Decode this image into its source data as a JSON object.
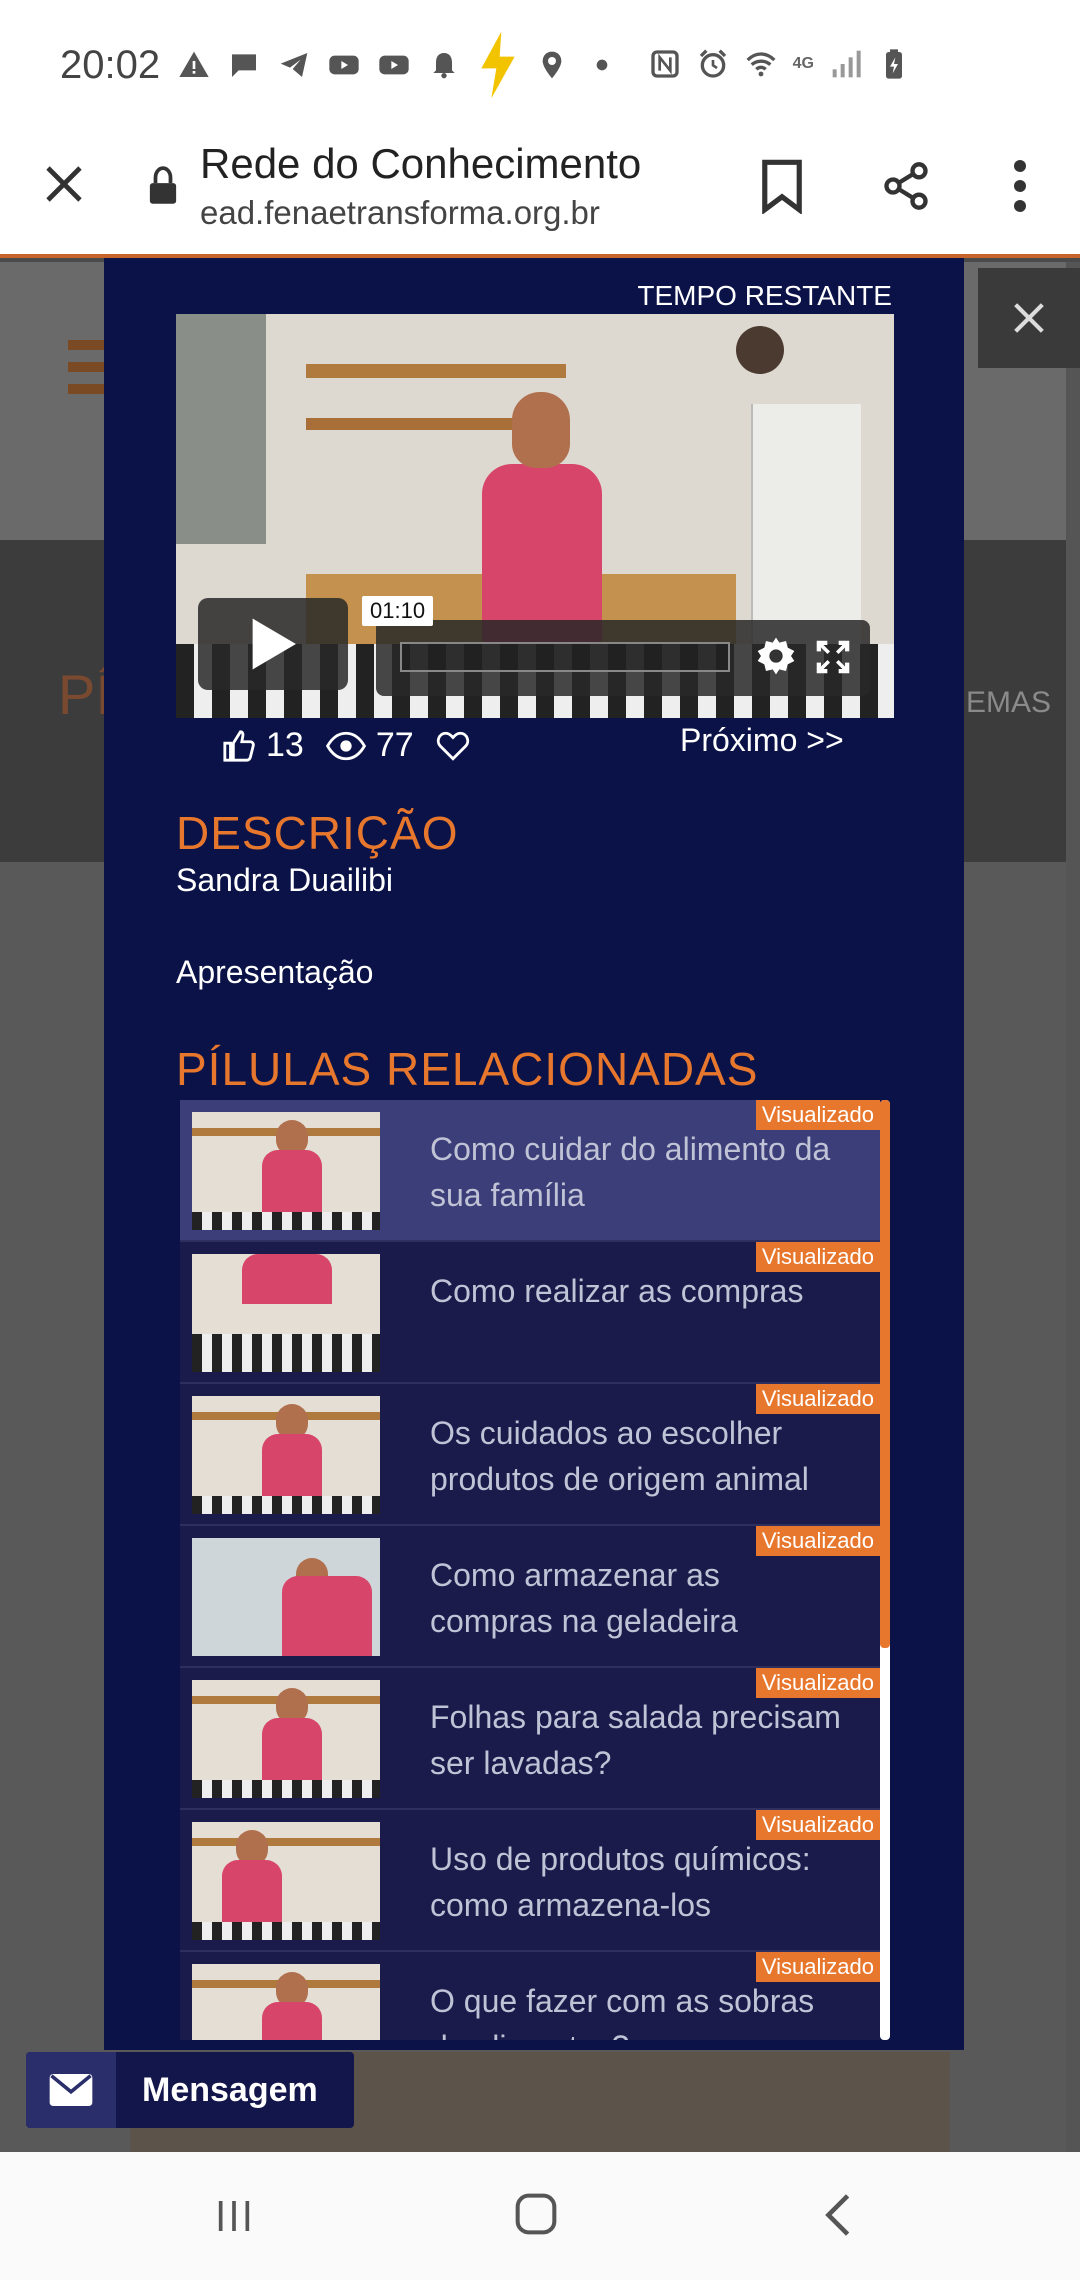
{
  "status_bar": {
    "time": "20:02",
    "icons_left": [
      "warning-icon",
      "chat-icon",
      "telegram-icon",
      "youtube-icon",
      "youtube-icon",
      "bell-icon",
      "bolt-icon",
      "location-icon",
      "dot-icon"
    ],
    "icons_right": [
      "nfc-icon",
      "alarm-icon",
      "wifi-icon",
      "4g-icon",
      "signal-icon",
      "battery-icon"
    ],
    "network": "4G"
  },
  "browser": {
    "title": "Rede do Conhecimento",
    "url": "ead.fenaetransforma.org.br"
  },
  "background_page": {
    "partial_heading": "PÍ",
    "partial_nav": "EMAS"
  },
  "modal": {
    "tempo_label": "TEMPO RESTANTE",
    "video": {
      "time_tooltip": "01:10"
    },
    "stats": {
      "likes": "13",
      "views": "77"
    },
    "next_label": "Próximo >>",
    "description_heading": "DESCRIÇÃO",
    "author": "Sandra Duailibi",
    "description_text": "Apresentação",
    "related_heading": "PÍLULAS RELACIONADAS",
    "related": [
      {
        "title": "Como cuidar do alimento da sua família",
        "badge": "Visualizado"
      },
      {
        "title": "Como realizar as compras",
        "badge": "Visualizado"
      },
      {
        "title": "Os cuidados ao escolher produtos de origem animal",
        "badge": "Visualizado"
      },
      {
        "title": "Como armazenar as compras na geladeira",
        "badge": "Visualizado"
      },
      {
        "title": "Folhas para salada precisam ser lavadas?",
        "badge": "Visualizado"
      },
      {
        "title": "Uso de produtos químicos: como armazena-los",
        "badge": "Visualizado"
      },
      {
        "title": "O que fazer com as sobras de alimentos?",
        "badge": "Visualizado"
      }
    ]
  },
  "message_button": {
    "label": "Mensagem"
  },
  "colors": {
    "accent": "#e8772e",
    "modal_bg": "#0a1247",
    "item_bg": "#1a1b4a",
    "active_item_bg": "#3b3e78"
  }
}
